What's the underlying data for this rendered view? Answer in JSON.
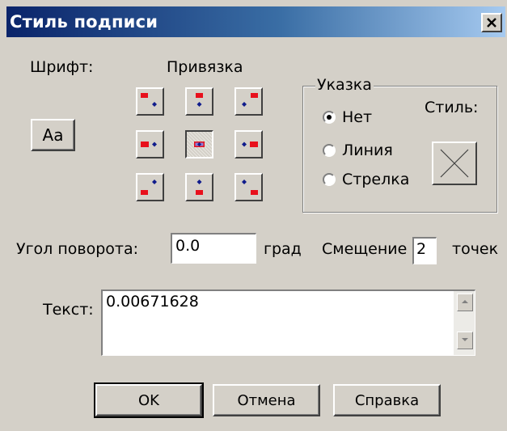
{
  "window": {
    "title": "Стиль подписи",
    "close_label": "X"
  },
  "font_section": {
    "label": "Шрифт:",
    "button_label": "Aa"
  },
  "anchor_section": {
    "label": "Привязка",
    "selected": "center"
  },
  "pointer_group": {
    "legend": "Указка",
    "options": [
      "Нет",
      "Линия",
      "Стрелка"
    ],
    "selected": "Нет",
    "style_label": "Стиль:"
  },
  "rotation": {
    "label": "Угол поворота:",
    "value": "0.0",
    "unit": "град"
  },
  "offset": {
    "label": "Смещение",
    "value": "2",
    "unit": "точек"
  },
  "text_field": {
    "label": "Текст:",
    "value": "0.00671628"
  },
  "buttons": {
    "ok": "OK",
    "cancel": "Отмена",
    "help": "Справка"
  },
  "colors": {
    "marker_red": "#e8101c",
    "marker_blue": "#101c8c"
  }
}
